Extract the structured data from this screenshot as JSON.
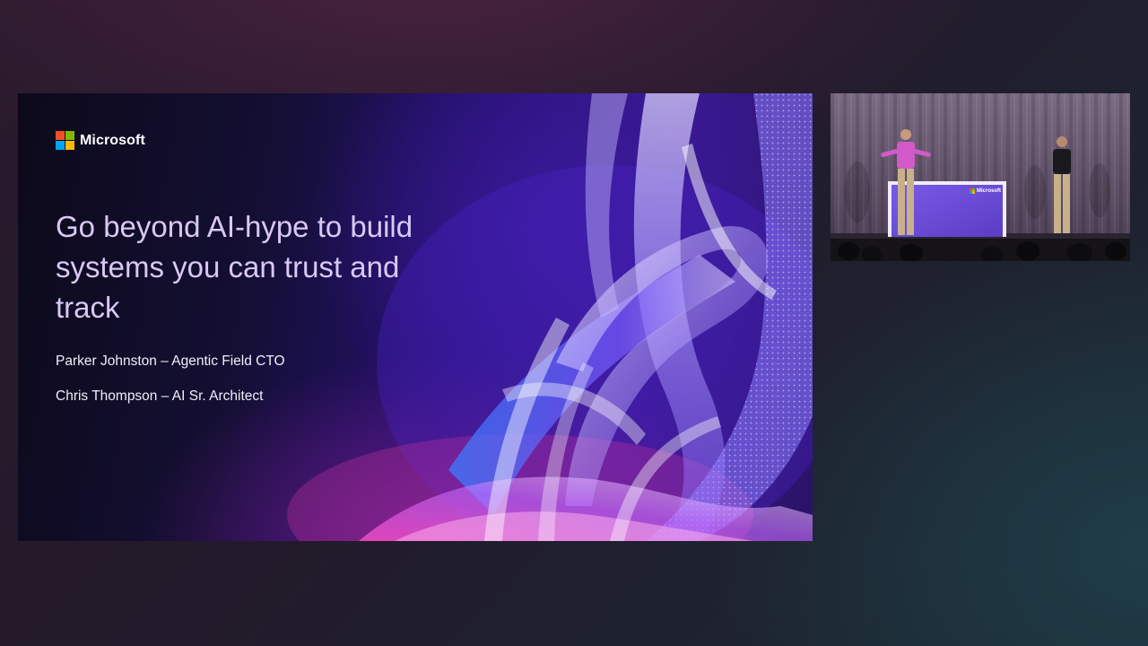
{
  "slide": {
    "brand": "Microsoft",
    "title": "Go beyond AI-hype to build systems you can trust and track",
    "presenters": [
      "Parker Johnston – Agentic Field CTO",
      "Chris Thompson – AI Sr. Architect"
    ]
  },
  "camera": {
    "podium_brand": "Microsoft"
  },
  "colors": {
    "ms_red": "#f25022",
    "ms_green": "#7fba00",
    "ms_blue": "#00a4ef",
    "ms_yellow": "#ffb900",
    "title_lilac": "#d9c8f3",
    "podium_purple": "#6a4fd6"
  }
}
